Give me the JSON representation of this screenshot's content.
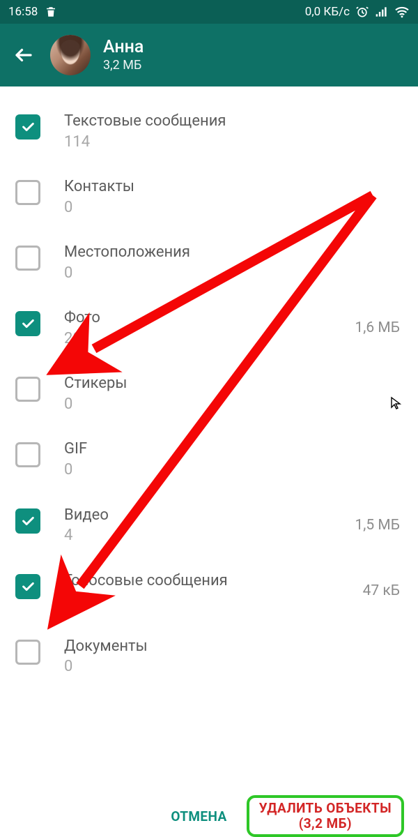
{
  "status": {
    "time": "16:58",
    "net": "0,0 КБ/с"
  },
  "header": {
    "name": "Анна",
    "size": "3,2 МБ"
  },
  "items": [
    {
      "label": "Текстовые сообщения",
      "count": "114",
      "size": "",
      "checked": true
    },
    {
      "label": "Контакты",
      "count": "0",
      "size": "",
      "checked": false
    },
    {
      "label": "Местоположения",
      "count": "0",
      "size": "",
      "checked": false
    },
    {
      "label": "Фото",
      "count": "20",
      "size": "1,6 МБ",
      "checked": true
    },
    {
      "label": "Стикеры",
      "count": "0",
      "size": "",
      "checked": false
    },
    {
      "label": "GIF",
      "count": "0",
      "size": "",
      "checked": false
    },
    {
      "label": "Видео",
      "count": "4",
      "size": "1,5 МБ",
      "checked": true
    },
    {
      "label": "Голосовые сообщения",
      "count": "12",
      "size": "47 кБ",
      "checked": true
    },
    {
      "label": "Документы",
      "count": "0",
      "size": "",
      "checked": false
    }
  ],
  "footer": {
    "cancel": "ОТМЕНА",
    "delete_line1": "УДАЛИТЬ ОБЪЕКТЫ",
    "delete_line2": "(3,2 МБ)"
  }
}
